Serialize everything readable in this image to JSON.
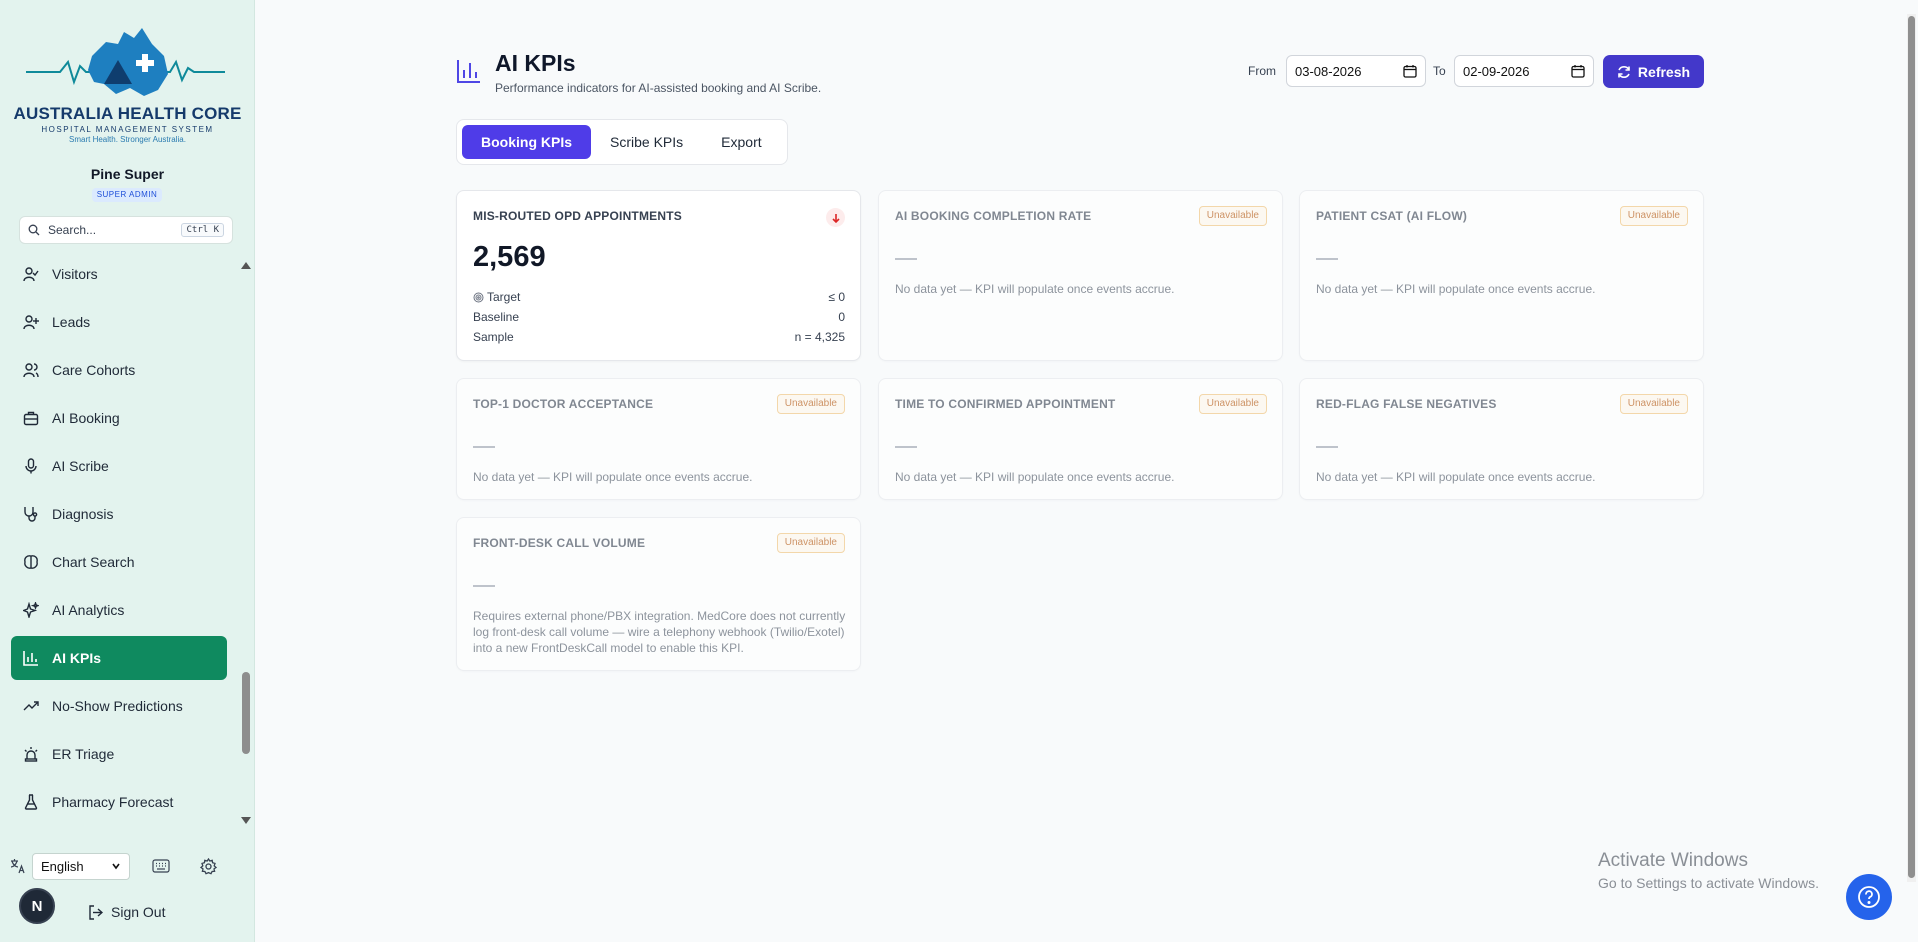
{
  "brand": {
    "name": "AUSTRALIA HEALTH CORE",
    "subtitle": "HOSPITAL MANAGEMENT SYSTEM",
    "tagline": "Smart Health. Stronger Australia."
  },
  "user": {
    "name": "Pine Super",
    "role": "SUPER ADMIN",
    "avatar_initial": "N"
  },
  "search": {
    "placeholder": "Search...",
    "shortcut": "Ctrl K"
  },
  "nav": [
    {
      "label": "Visitors",
      "icon": "user-check-icon"
    },
    {
      "label": "Leads",
      "icon": "user-plus-icon"
    },
    {
      "label": "Care Cohorts",
      "icon": "users-icon"
    },
    {
      "label": "AI Booking",
      "icon": "briefcase-icon"
    },
    {
      "label": "AI Scribe",
      "icon": "microphone-icon"
    },
    {
      "label": "Diagnosis",
      "icon": "stethoscope-icon"
    },
    {
      "label": "Chart Search",
      "icon": "brain-icon"
    },
    {
      "label": "AI Analytics",
      "icon": "sparkles-icon"
    },
    {
      "label": "AI KPIs",
      "icon": "bar-chart-icon",
      "active": true
    },
    {
      "label": "No-Show Predictions",
      "icon": "trending-up-icon"
    },
    {
      "label": "ER Triage",
      "icon": "siren-icon"
    },
    {
      "label": "Pharmacy Forecast",
      "icon": "flask-icon"
    }
  ],
  "footer": {
    "language": "English",
    "sign_out": "Sign Out"
  },
  "page": {
    "title": "AI KPIs",
    "subtitle": "Performance indicators for AI-assisted booking and AI Scribe.",
    "from_label": "From",
    "from_value": "03-08-2026",
    "to_label": "To",
    "to_value": "02-09-2026",
    "refresh_label": "Refresh"
  },
  "tabs": [
    {
      "label": "Booking KPIs",
      "active": true
    },
    {
      "label": "Scribe KPIs"
    },
    {
      "label": "Export"
    }
  ],
  "kpis": {
    "misrouted": {
      "title": "MIS-ROUTED OPD APPOINTMENTS",
      "value": "2,569",
      "target_label": "Target",
      "target_value": "≤ 0",
      "baseline_label": "Baseline",
      "baseline_value": "0",
      "sample_label": "Sample",
      "sample_value": "n = 4,325"
    },
    "completion": {
      "title": "AI BOOKING COMPLETION RATE",
      "status": "Unavailable",
      "message": "No data yet — KPI will populate once events accrue."
    },
    "csat": {
      "title": "PATIENT CSAT (AI FLOW)",
      "status": "Unavailable",
      "message": "No data yet — KPI will populate once events accrue."
    },
    "top1": {
      "title": "TOP-1 DOCTOR ACCEPTANCE",
      "status": "Unavailable",
      "message": "No data yet — KPI will populate once events accrue."
    },
    "time_confirmed": {
      "title": "TIME TO CONFIRMED APPOINTMENT",
      "status": "Unavailable",
      "message": "No data yet — KPI will populate once events accrue."
    },
    "redflag": {
      "title": "RED-FLAG FALSE NEGATIVES",
      "status": "Unavailable",
      "message": "No data yet — KPI will populate once events accrue."
    },
    "frontdesk": {
      "title": "FRONT-DESK CALL VOLUME",
      "status": "Unavailable",
      "message": "Requires external phone/PBX integration. MedCore does not currently log front-desk call volume — wire a telephony webhook (Twilio/Exotel) into a new FrontDeskCall model to enable this KPI."
    }
  },
  "watermark": {
    "line1": "Activate Windows",
    "line2": "Go to Settings to activate Windows."
  },
  "colors": {
    "primary": "#4338ca",
    "active_nav": "#0f8a5f",
    "sidebar_bg": "#e3f3ee",
    "unavailable": "#b45309"
  }
}
